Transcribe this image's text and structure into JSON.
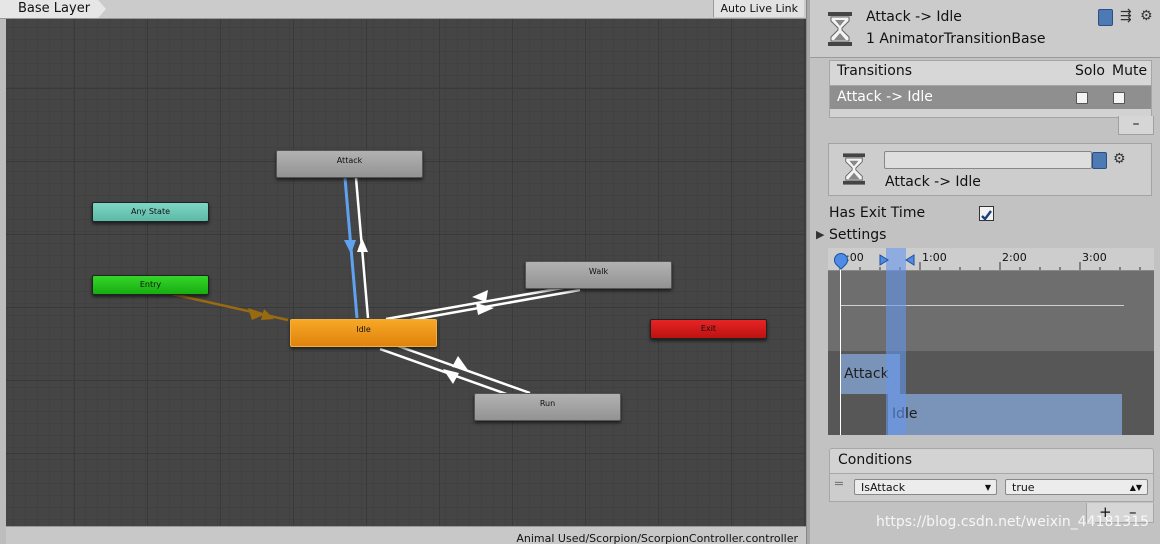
{
  "graph": {
    "breadcrumb": "Base Layer",
    "live_link": "Auto Live Link",
    "asset_path": "Animal Used/Scorpion/ScorpionController.controller",
    "states": {
      "attack": "Attack",
      "any_state": "Any State",
      "entry": "Entry",
      "idle": "Idle",
      "walk": "Walk",
      "exit": "Exit",
      "run": "Run"
    }
  },
  "inspector": {
    "title": "Attack -> Idle",
    "subtitle": "1 AnimatorTransitionBase",
    "transitions": {
      "header": "Transitions",
      "solo": "Solo",
      "mute": "Mute",
      "rows": [
        {
          "name": "Attack -> Idle",
          "solo": false,
          "mute": false
        }
      ],
      "remove": "–"
    },
    "transition": {
      "name_value": "",
      "label": "Attack -> Idle"
    },
    "has_exit_time": {
      "label": "Has Exit Time",
      "checked": true
    },
    "settings": {
      "label": "Settings",
      "expanded": false
    },
    "timeline": {
      "ticks": [
        ":00",
        "1:00",
        "2:00",
        "3:00"
      ],
      "tracks": {
        "source": "Attack",
        "destination": "Idle"
      }
    },
    "conditions": {
      "header": "Conditions",
      "rows": [
        {
          "parameter": "IsAttack",
          "value": "true"
        }
      ],
      "add": "+",
      "remove": "–"
    }
  },
  "watermark": "https://blog.csdn.net/weixin_44181315",
  "colors": {
    "idle": "#e0830d",
    "entry": "#16ad10",
    "any_state": "#5db8a6",
    "exit": "#bd1111",
    "selected_transition": "#5ea2f0",
    "entry_transition": "#9a6b0e"
  }
}
